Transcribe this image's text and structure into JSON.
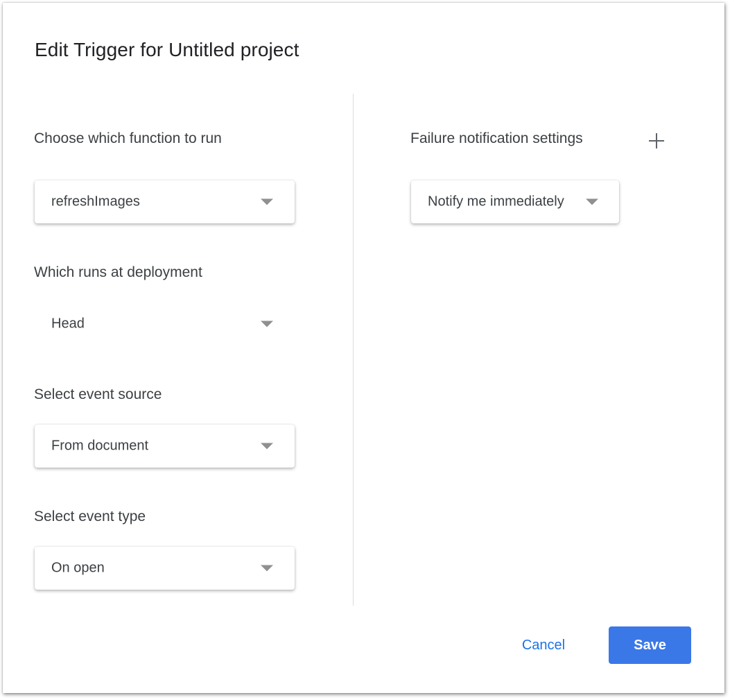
{
  "dialog": {
    "title": "Edit Trigger for Untitled project"
  },
  "left": {
    "function": {
      "label": "Choose which function to run",
      "value": "refreshImages"
    },
    "deployment": {
      "label": "Which runs at deployment",
      "value": "Head"
    },
    "event_source": {
      "label": "Select event source",
      "value": "From document"
    },
    "event_type": {
      "label": "Select event type",
      "value": "On open"
    }
  },
  "right": {
    "failure": {
      "label": "Failure notification settings",
      "value": "Notify me immediately",
      "add_icon": "plus-icon"
    }
  },
  "footer": {
    "cancel_label": "Cancel",
    "save_label": "Save"
  },
  "colors": {
    "accent": "#1a73e8",
    "save_bg": "#3b78e7",
    "text": "#3c4043",
    "divider": "#dadce0"
  }
}
